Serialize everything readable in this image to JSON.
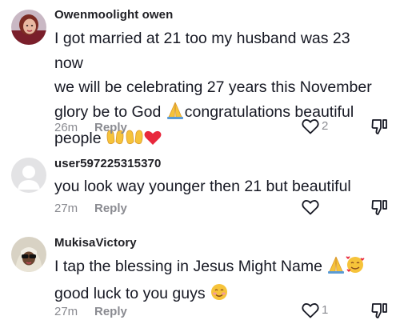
{
  "comments": [
    {
      "username": "Owenmoolight owen",
      "lines": [
        "I got married at 21 too my husband was 23 now",
        "we will be celebrating 27 years this November",
        "glory be to God ",
        "congratulations beautiful",
        "people "
      ],
      "emojis": [
        "folded-hands",
        "raising-hands",
        "raising-hands",
        "red-heart"
      ],
      "time": "26m",
      "reply_label": "Reply",
      "likes": "2",
      "avatar": "profile-photo"
    },
    {
      "username": "user597225315370",
      "lines": [
        "you look way younger then 21 but beautiful"
      ],
      "emojis": [],
      "time": "27m",
      "reply_label": "Reply",
      "likes": "",
      "avatar": "default-avatar"
    },
    {
      "username": "MukisaVictory",
      "lines": [
        "I tap the blessing in Jesus Might Name ",
        "good luck to you guys "
      ],
      "emojis": [
        "folded-hands",
        "smiling-face-with-hearts",
        "smiling-face"
      ],
      "time": "27m",
      "reply_label": "Reply",
      "likes": "1",
      "avatar": "profile-photo"
    }
  ],
  "icons": {
    "like": "heart-outline-icon",
    "dislike": "thumbs-down-icon"
  },
  "colors": {
    "text": "#161823",
    "muted": "#8a8b91",
    "heart": "#e8283c",
    "emoji_yellow": "#f6c33a"
  }
}
